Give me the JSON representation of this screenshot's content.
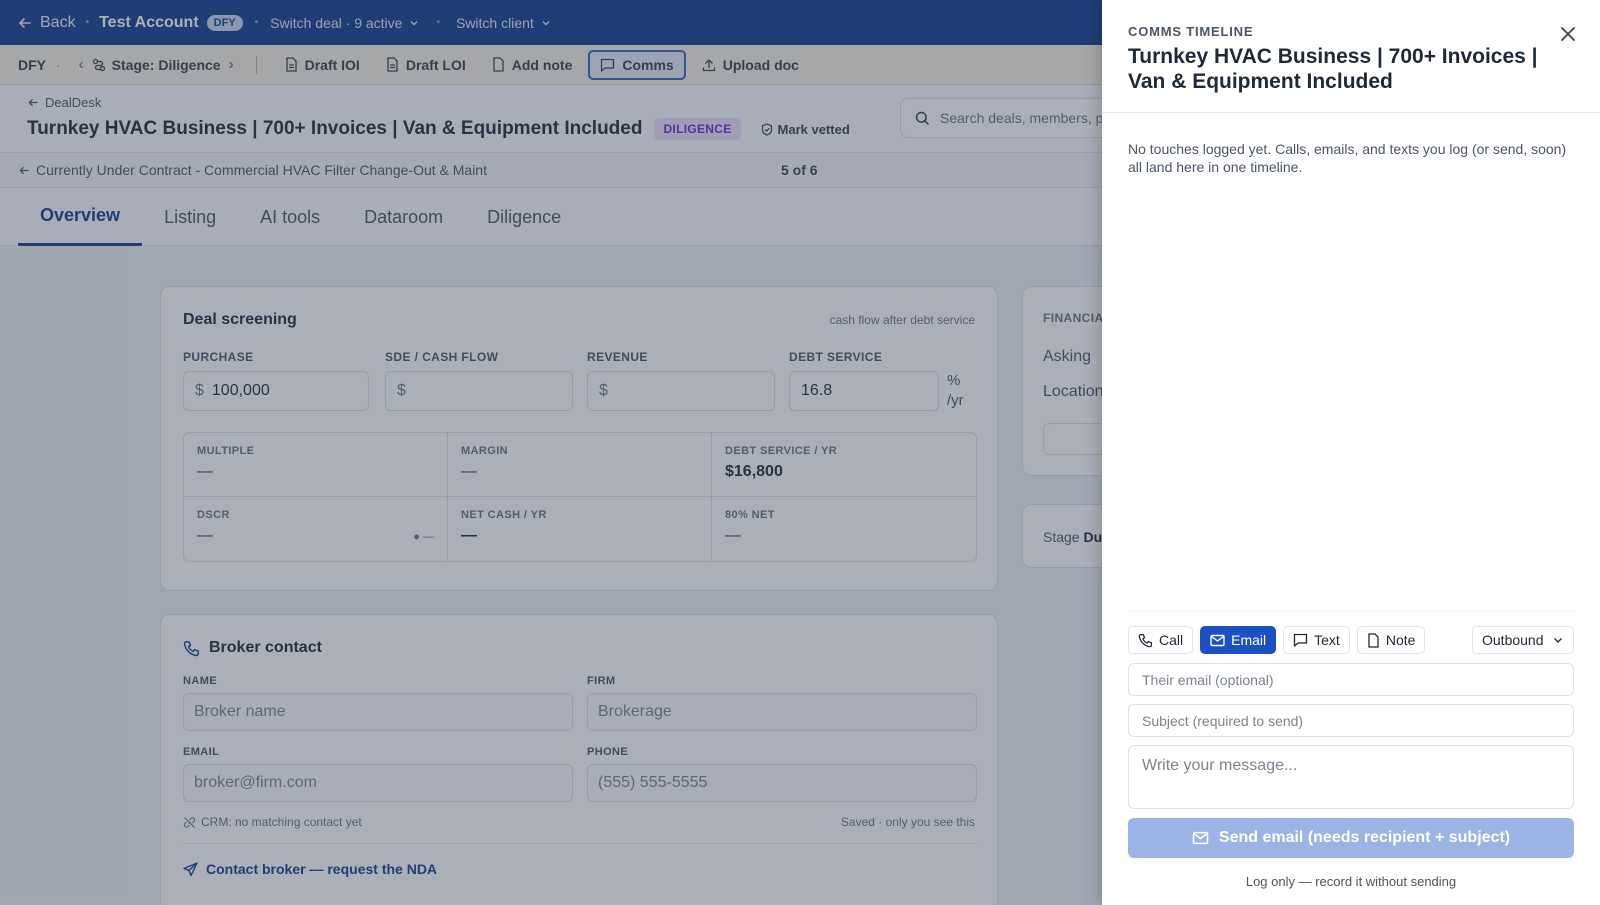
{
  "topbar": {
    "back_label": "Back",
    "account_name": "Test Account",
    "account_badge": "DFY",
    "switch_deal_label": "Switch deal · 9 active",
    "switch_client_label": "Switch client"
  },
  "toolbar": {
    "client_code": "DFY",
    "stage_label": "Stage: Diligence",
    "buttons": [
      {
        "label": "Draft IOI",
        "icon": "document-icon"
      },
      {
        "label": "Draft LOI",
        "icon": "document-icon"
      },
      {
        "label": "Add note",
        "icon": "note-icon"
      },
      {
        "label": "Comms",
        "icon": "chat-icon",
        "active": true
      },
      {
        "label": "Upload doc",
        "icon": "upload-icon"
      }
    ]
  },
  "header": {
    "breadcrumb": "DealDesk",
    "title": "Turnkey HVAC Business | 700+ Invoices | Van & Equipment Included",
    "status_badge": "DILIGENCE",
    "mark_vetted_label": "Mark vetted",
    "search_placeholder": "Search deals, members, p"
  },
  "subnav": {
    "previous_deal": "Currently Under Contract - Commercial HVAC Filter Change-Out & Maint",
    "position": "5 of 6"
  },
  "tabs": [
    {
      "label": "Overview",
      "active": true
    },
    {
      "label": "Listing"
    },
    {
      "label": "AI tools"
    },
    {
      "label": "Dataroom"
    },
    {
      "label": "Diligence"
    }
  ],
  "screening": {
    "title": "Deal screening",
    "hint": "cash flow after debt service",
    "fields": {
      "purchase_label": "PURCHASE",
      "purchase_currency": "$",
      "purchase_value": "100,000",
      "sde_label": "SDE / CASH FLOW",
      "sde_currency": "$",
      "revenue_label": "REVENUE",
      "revenue_currency": "$",
      "debt_label": "DEBT SERVICE",
      "debt_value": "16.8",
      "debt_unit_1": "%",
      "debt_unit_2": "/yr"
    },
    "metrics": [
      {
        "label": "MULTIPLE",
        "value": "—"
      },
      {
        "label": "MARGIN",
        "value": "—"
      },
      {
        "label": "DEBT SERVICE / YR",
        "value": "$16,800"
      },
      {
        "label": "DSCR",
        "value": "—",
        "indicator": "● —"
      },
      {
        "label": "NET CASH / YR",
        "value": "—"
      },
      {
        "label": "80% NET",
        "value": "—"
      }
    ]
  },
  "broker": {
    "title": "Broker contact",
    "name_label": "NAME",
    "name_placeholder": "Broker name",
    "firm_label": "FIRM",
    "firm_placeholder": "Brokerage",
    "email_label": "EMAIL",
    "email_placeholder": "broker@firm.com",
    "phone_label": "PHONE",
    "phone_placeholder": "(555) 555-5555",
    "crm_status": "CRM: no matching contact yet",
    "saved_note": "Saved · only you see this",
    "contact_link": "Contact broker — request the NDA"
  },
  "side": {
    "financials_label": "FINANCIA",
    "asking_label": "Asking",
    "location_label": "Location",
    "stage_prefix": "Stage",
    "stage_value": "Du"
  },
  "drawer": {
    "kicker": "COMMS TIMELINE",
    "title": "Turnkey HVAC Business | 700+ Invoices | Van & Equipment Included",
    "empty_message": "No touches logged yet. Calls, emails, and texts you log (or send, soon) all land here in one timeline.",
    "channels": [
      {
        "label": "Call",
        "icon": "phone-icon"
      },
      {
        "label": "Email",
        "icon": "mail-icon",
        "active": true
      },
      {
        "label": "Text",
        "icon": "chat-icon"
      },
      {
        "label": "Note",
        "icon": "note-icon"
      }
    ],
    "direction": "Outbound",
    "email_placeholder": "Their email (optional)",
    "subject_placeholder": "Subject (required to send)",
    "message_placeholder": "Write your message...",
    "send_label": "Send email (needs recipient + subject)",
    "log_only_label": "Log only — record it without sending"
  },
  "colors": {
    "brand": "#0f3d8c",
    "accent": "#1b51c2",
    "send_disabled": "#9ab4e6",
    "badge_purple": "#6d28d9"
  }
}
